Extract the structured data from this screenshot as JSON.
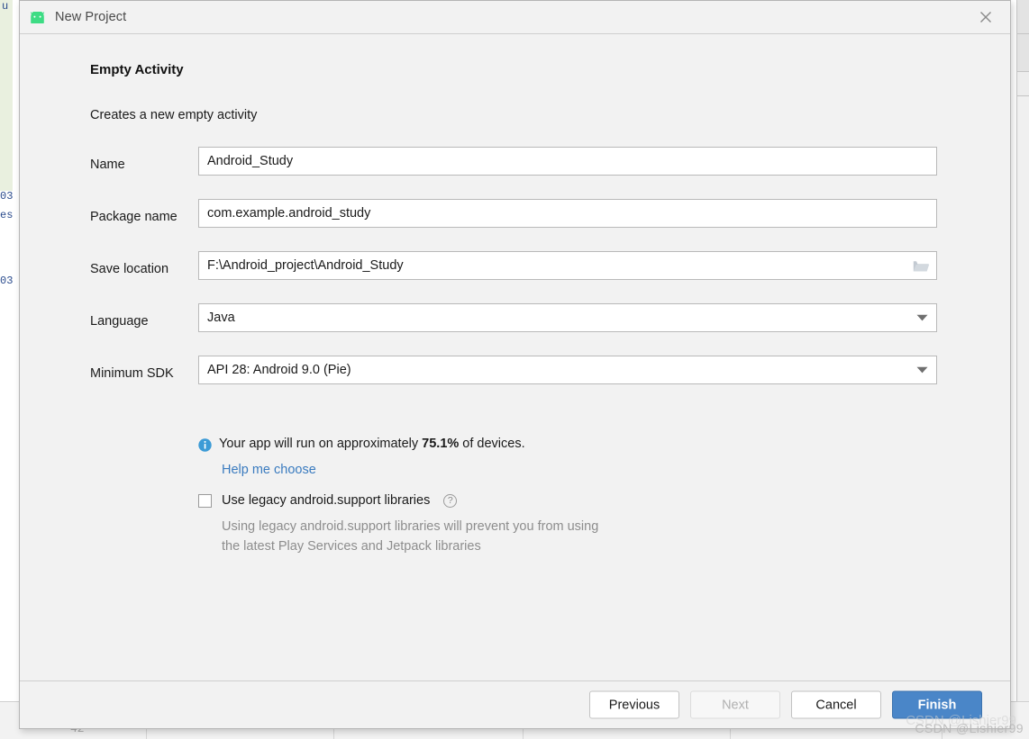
{
  "window": {
    "title": "New Project",
    "app_icon": "android-robot-icon",
    "close_icon": "close-icon"
  },
  "wizard": {
    "step_title": "Empty Activity",
    "step_description": "Creates a new empty activity"
  },
  "form": {
    "fields": [
      {
        "label": "Name",
        "value": "Android_Study",
        "placeholder": "",
        "control": "text",
        "name": "project-name"
      },
      {
        "label": "Package name",
        "value": "com.example.android_study",
        "placeholder": "",
        "control": "text",
        "name": "package-name"
      },
      {
        "label": "Save location",
        "value": "F:\\Android_project\\Android_Study",
        "placeholder": "",
        "control": "text-with-browse",
        "browse_icon": "folder-icon",
        "name": "save-location"
      },
      {
        "label": "Language",
        "value": "Java",
        "placeholder": "",
        "control": "dropdown",
        "dropdown_icon": "chevron-down-icon",
        "name": "language"
      },
      {
        "label": "Minimum SDK",
        "value": "API 28: Android 9.0 (Pie)",
        "placeholder": "",
        "control": "dropdown",
        "dropdown_icon": "chevron-down-icon",
        "name": "minimum-sdk"
      }
    ]
  },
  "device_info": {
    "icon": "info-circle-icon",
    "text_before": "Your app will run on approximately ",
    "percent": "75.1%",
    "text_after": " of devices.",
    "help_link": "Help me choose"
  },
  "legacy": {
    "checked": false,
    "label": "Use legacy android.support libraries",
    "help_icon": "question-mark-icon",
    "note_line1": "Using legacy android.support libraries will prevent you from using",
    "note_line2": "the latest Play Services and Jetpack libraries"
  },
  "footer": {
    "buttons": [
      {
        "label": "Previous",
        "state": "enabled",
        "name": "previous-button"
      },
      {
        "label": "Next",
        "state": "disabled",
        "name": "next-button"
      },
      {
        "label": "Cancel",
        "state": "enabled",
        "name": "cancel-button"
      },
      {
        "label": "Finish",
        "state": "primary",
        "name": "finish-button"
      }
    ]
  },
  "watermark": {
    "text": "CSDN @Lishier99"
  },
  "background": {
    "code_fragments": [
      "03",
      "es",
      "03",
      "u"
    ],
    "line_number": "42"
  },
  "colors": {
    "accent": "#4a86c8",
    "link": "#3a7bbf",
    "info": "#3c9bd6",
    "android_green": "#3ddc84",
    "dialog_bg": "#f2f2f2",
    "teal": "#1a9a94"
  }
}
